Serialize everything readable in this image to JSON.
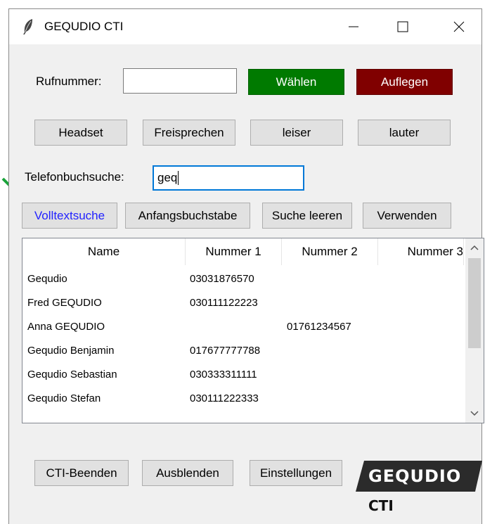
{
  "window": {
    "title": "GEQUDIO CTI",
    "min_glyph": "—",
    "max_glyph": "☐",
    "close_glyph": "✕"
  },
  "dial": {
    "label": "Rufnummer:",
    "value": "",
    "call_label": "Wählen",
    "hangup_label": "Auflegen",
    "call_color": "#007a00",
    "hangup_color": "#800000"
  },
  "audio": {
    "headset": "Headset",
    "speaker": "Freisprechen",
    "quieter": "leiser",
    "louder": "lauter"
  },
  "phonebook": {
    "label": "Telefonbuchsuche:",
    "value": "geq"
  },
  "search": {
    "fulltext": "Volltextsuche",
    "prefix": "Anfangsbuchstabe",
    "clear": "Suche leeren",
    "use": "Verwenden"
  },
  "table": {
    "columns": [
      "Name",
      "Nummer 1",
      "Nummer 2",
      "Nummer 3"
    ],
    "rows": [
      [
        "Gequdio",
        "03031876570",
        "",
        ""
      ],
      [
        "Fred GEQUDIO",
        "030111122223",
        "",
        ""
      ],
      [
        "Anna GEQUDIO",
        "",
        "01761234567",
        ""
      ],
      [
        "Gequdio Benjamin",
        "017677777788",
        "",
        ""
      ],
      [
        "Gequdio Sebastian",
        "030333311111",
        "",
        ""
      ],
      [
        "Gequdio Stefan",
        "030111222333",
        "",
        ""
      ]
    ]
  },
  "footer": {
    "quit": "CTI-Beenden",
    "hide": "Ausblenden",
    "settings": "Einstellungen"
  },
  "logo": {
    "brand": "GEQUDIO",
    "sub": "CTI"
  },
  "colors": {
    "arrow": "#1aa33a",
    "highlight_text": "#2222ff"
  }
}
